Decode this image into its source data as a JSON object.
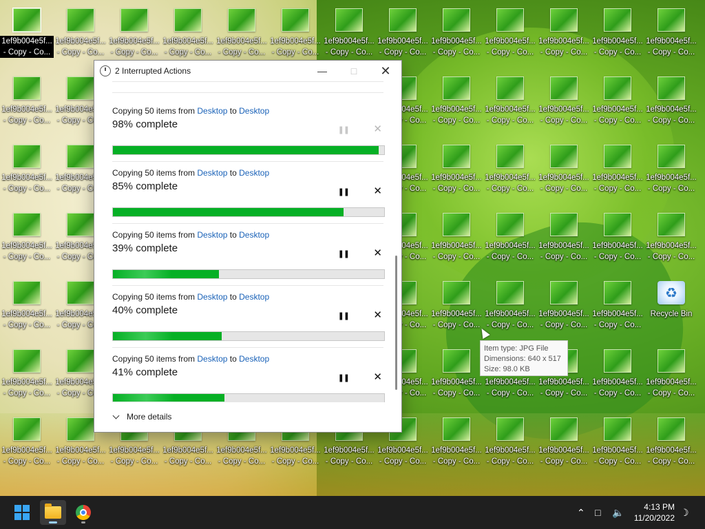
{
  "desktop": {
    "icon_label_line1": "1ef9b004e5f...",
    "icon_label_line2": "- Copy - Co...",
    "recycle_bin_label": "Recycle Bin"
  },
  "dialog": {
    "title": "2 Interrupted Actions",
    "operations": [
      {
        "prefix": "Copying 50 items from ",
        "source": "Desktop",
        "to": " to ",
        "dest": "Desktop",
        "percent_text": "98% complete",
        "progress": 0.98,
        "paused_button_disabled": true
      },
      {
        "prefix": "Copying 50 items from ",
        "source": "Desktop",
        "to": " to ",
        "dest": "Desktop",
        "percent_text": "85% complete",
        "progress": 0.85,
        "paused_button_disabled": false
      },
      {
        "prefix": "Copying 50 items from ",
        "source": "Desktop",
        "to": " to ",
        "dest": "Desktop",
        "percent_text": "39% complete",
        "progress": 0.39,
        "paused_button_disabled": false
      },
      {
        "prefix": "Copying 50 items from ",
        "source": "Desktop",
        "to": " to ",
        "dest": "Desktop",
        "percent_text": "40% complete",
        "progress": 0.4,
        "paused_button_disabled": false
      },
      {
        "prefix": "Copying 50 items from ",
        "source": "Desktop",
        "to": " to ",
        "dest": "Desktop",
        "percent_text": "41% complete",
        "progress": 0.41,
        "paused_button_disabled": false
      }
    ],
    "more_details": "More details",
    "progress_color": "#06b025",
    "link_color": "#1a62b8"
  },
  "tooltip": {
    "item_type": "Item type: JPG File",
    "dimensions": "Dimensions: 640 x 517",
    "size": "Size: 98.0 KB"
  },
  "taskbar": {
    "time": "4:13 PM",
    "date": "11/20/2022",
    "apps": [
      "start-menu",
      "file-explorer",
      "google-chrome"
    ]
  }
}
